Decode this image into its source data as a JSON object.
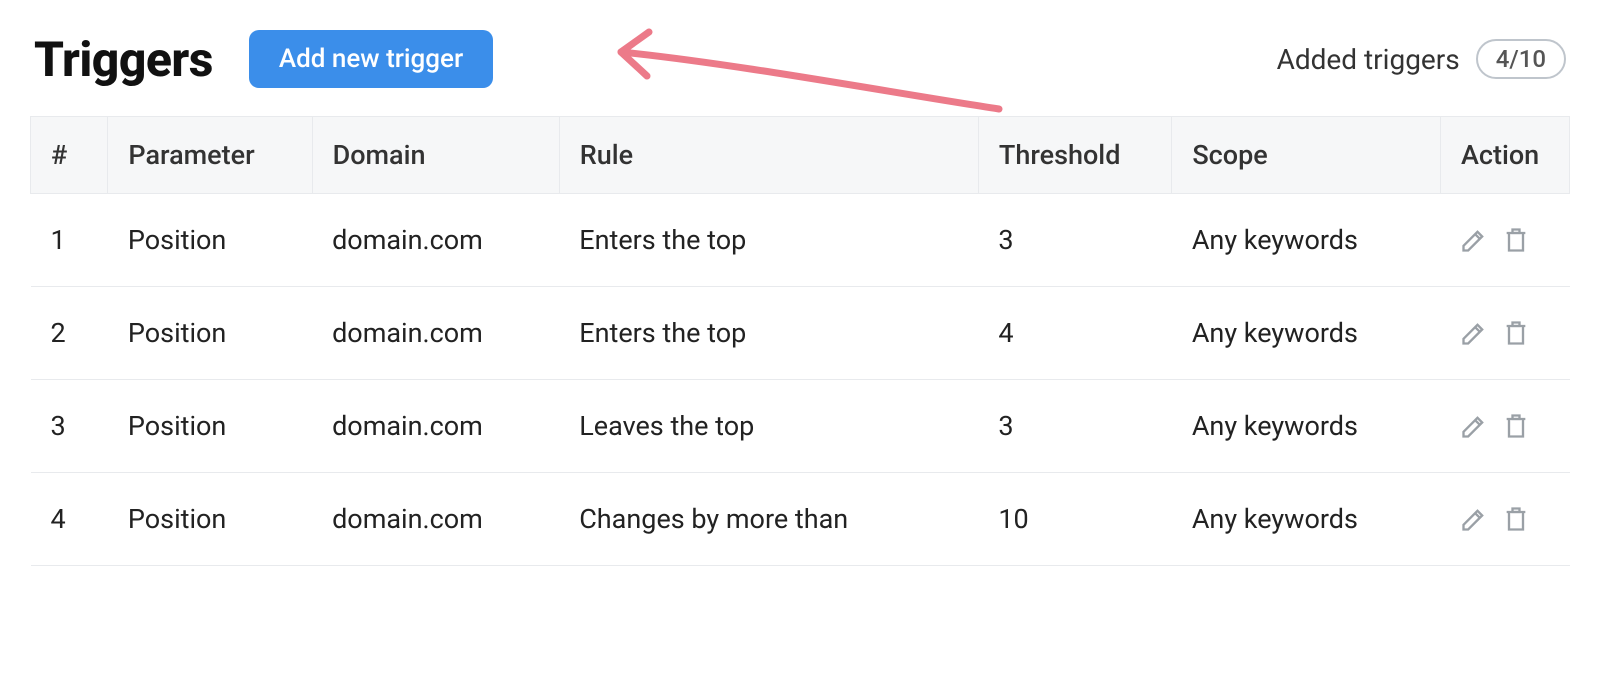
{
  "header": {
    "title": "Triggers",
    "add_button": "Add new trigger",
    "added_label": "Added triggers",
    "count_badge": "4/10"
  },
  "table": {
    "columns": {
      "num": "#",
      "parameter": "Parameter",
      "domain": "Domain",
      "rule": "Rule",
      "threshold": "Threshold",
      "scope": "Scope",
      "action": "Action"
    },
    "rows": [
      {
        "num": "1",
        "parameter": "Position",
        "domain": "domain.com",
        "rule": "Enters the top",
        "threshold": "3",
        "scope": "Any keywords"
      },
      {
        "num": "2",
        "parameter": "Position",
        "domain": "domain.com",
        "rule": "Enters the top",
        "threshold": "4",
        "scope": "Any keywords"
      },
      {
        "num": "3",
        "parameter": "Position",
        "domain": "domain.com",
        "rule": "Leaves the top",
        "threshold": "3",
        "scope": "Any keywords"
      },
      {
        "num": "4",
        "parameter": "Position",
        "domain": "domain.com",
        "rule": "Changes by more than",
        "threshold": "10",
        "scope": "Any keywords"
      }
    ]
  },
  "colors": {
    "accent_button": "#3b8eea",
    "arrow": "#ec7a89",
    "border": "#e8eaed",
    "header_bg": "#f6f7f8"
  }
}
